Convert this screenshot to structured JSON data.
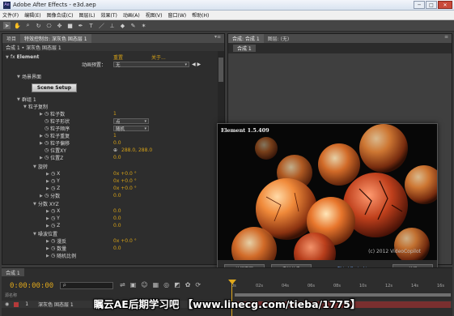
{
  "window": {
    "title": "Adobe After Effects - e3d.aep"
  },
  "menu": [
    "文件(F)",
    "编辑(E)",
    "图像合成(C)",
    "图层(L)",
    "效果(T)",
    "动画(A)",
    "视图(V)",
    "窗口(W)",
    "帮助(H)"
  ],
  "effect_controls": {
    "tab_project": "项目",
    "tab_label": "特效控制台: 深灰色 固态层 1",
    "subheader": "合成 1 • 深灰色 固态层 1",
    "effect_name": "Element",
    "reset_label": "重置",
    "about_label": "关于...",
    "preset_label": "动画预置：",
    "preset_value": "无",
    "scene_group": "场景界面",
    "scene_setup_button": "Scene Setup",
    "group1": "群组 1",
    "particle_replicate": "粒子复制",
    "particle_count": "粒子数",
    "particle_count_value": "1",
    "particle_shape": "粒子形状",
    "particle_shape_value": "点",
    "particle_order": "粒子顺序",
    "particle_order_value": "随机",
    "particle_repeat": "粒子重复",
    "particle_repeat_value": "1",
    "particle_offset": "粒子偏移",
    "particle_offset_value": "0.0",
    "position_xy": "位置XY",
    "position_xy_value": "288.0, 288.0",
    "position_z": "位置Z",
    "position_z_value": "0.0",
    "rotation": "旋转",
    "rot_x": "X",
    "rot_x_value": "0x +0.0 °",
    "rot_y": "Y",
    "rot_y_value": "0x +0.0 °",
    "rot_z": "Z",
    "rot_z_value": "0x +0.0 °",
    "scale": "分数",
    "scale_value": "0.0",
    "scale_xyz": "分数 XYZ",
    "sx": "X",
    "sx_value": "0.0",
    "sy": "Y",
    "sy_value": "0.0",
    "sz": "Z",
    "sz_value": "0.0",
    "noise_position": "噪波位置",
    "noise_opacity": "漫反",
    "noise_opacity_value": "0x +0.0 °",
    "noise_amount": "数量",
    "noise_amount_value": "0.0",
    "noise_phase": "随机比例"
  },
  "composition": {
    "tab_label": "合成: 合成 1",
    "footage_tab": "图层: (无)",
    "sub_tab": "合成 1"
  },
  "splash": {
    "title": "Element 1.5.409",
    "copyright": "(c) 2012 VideoCopilot",
    "buttons": {
      "visit": "访问官网",
      "system_info": "系统信息",
      "third_party": "Third-Party Licenses",
      "close": "关闭"
    }
  },
  "timeline": {
    "tab_label": "合成 1",
    "timecode": "0:00:00:00",
    "search_placeholder": "ρ",
    "col_source": "源名称",
    "ruler": [
      "0s",
      "02s",
      "04s",
      "06s",
      "08s",
      "10s",
      "12s",
      "14s",
      "16s"
    ],
    "layer_index": "1",
    "layer_name": "深灰色 固态层 1"
  },
  "watermark": "瞩云AE后期学习吧  【www.linecg.com/tieba/1775】",
  "colors": {
    "accent_orange": "#d4a017",
    "panel_bg": "#2d2d2d",
    "layer_red": "#7a2f2f"
  }
}
